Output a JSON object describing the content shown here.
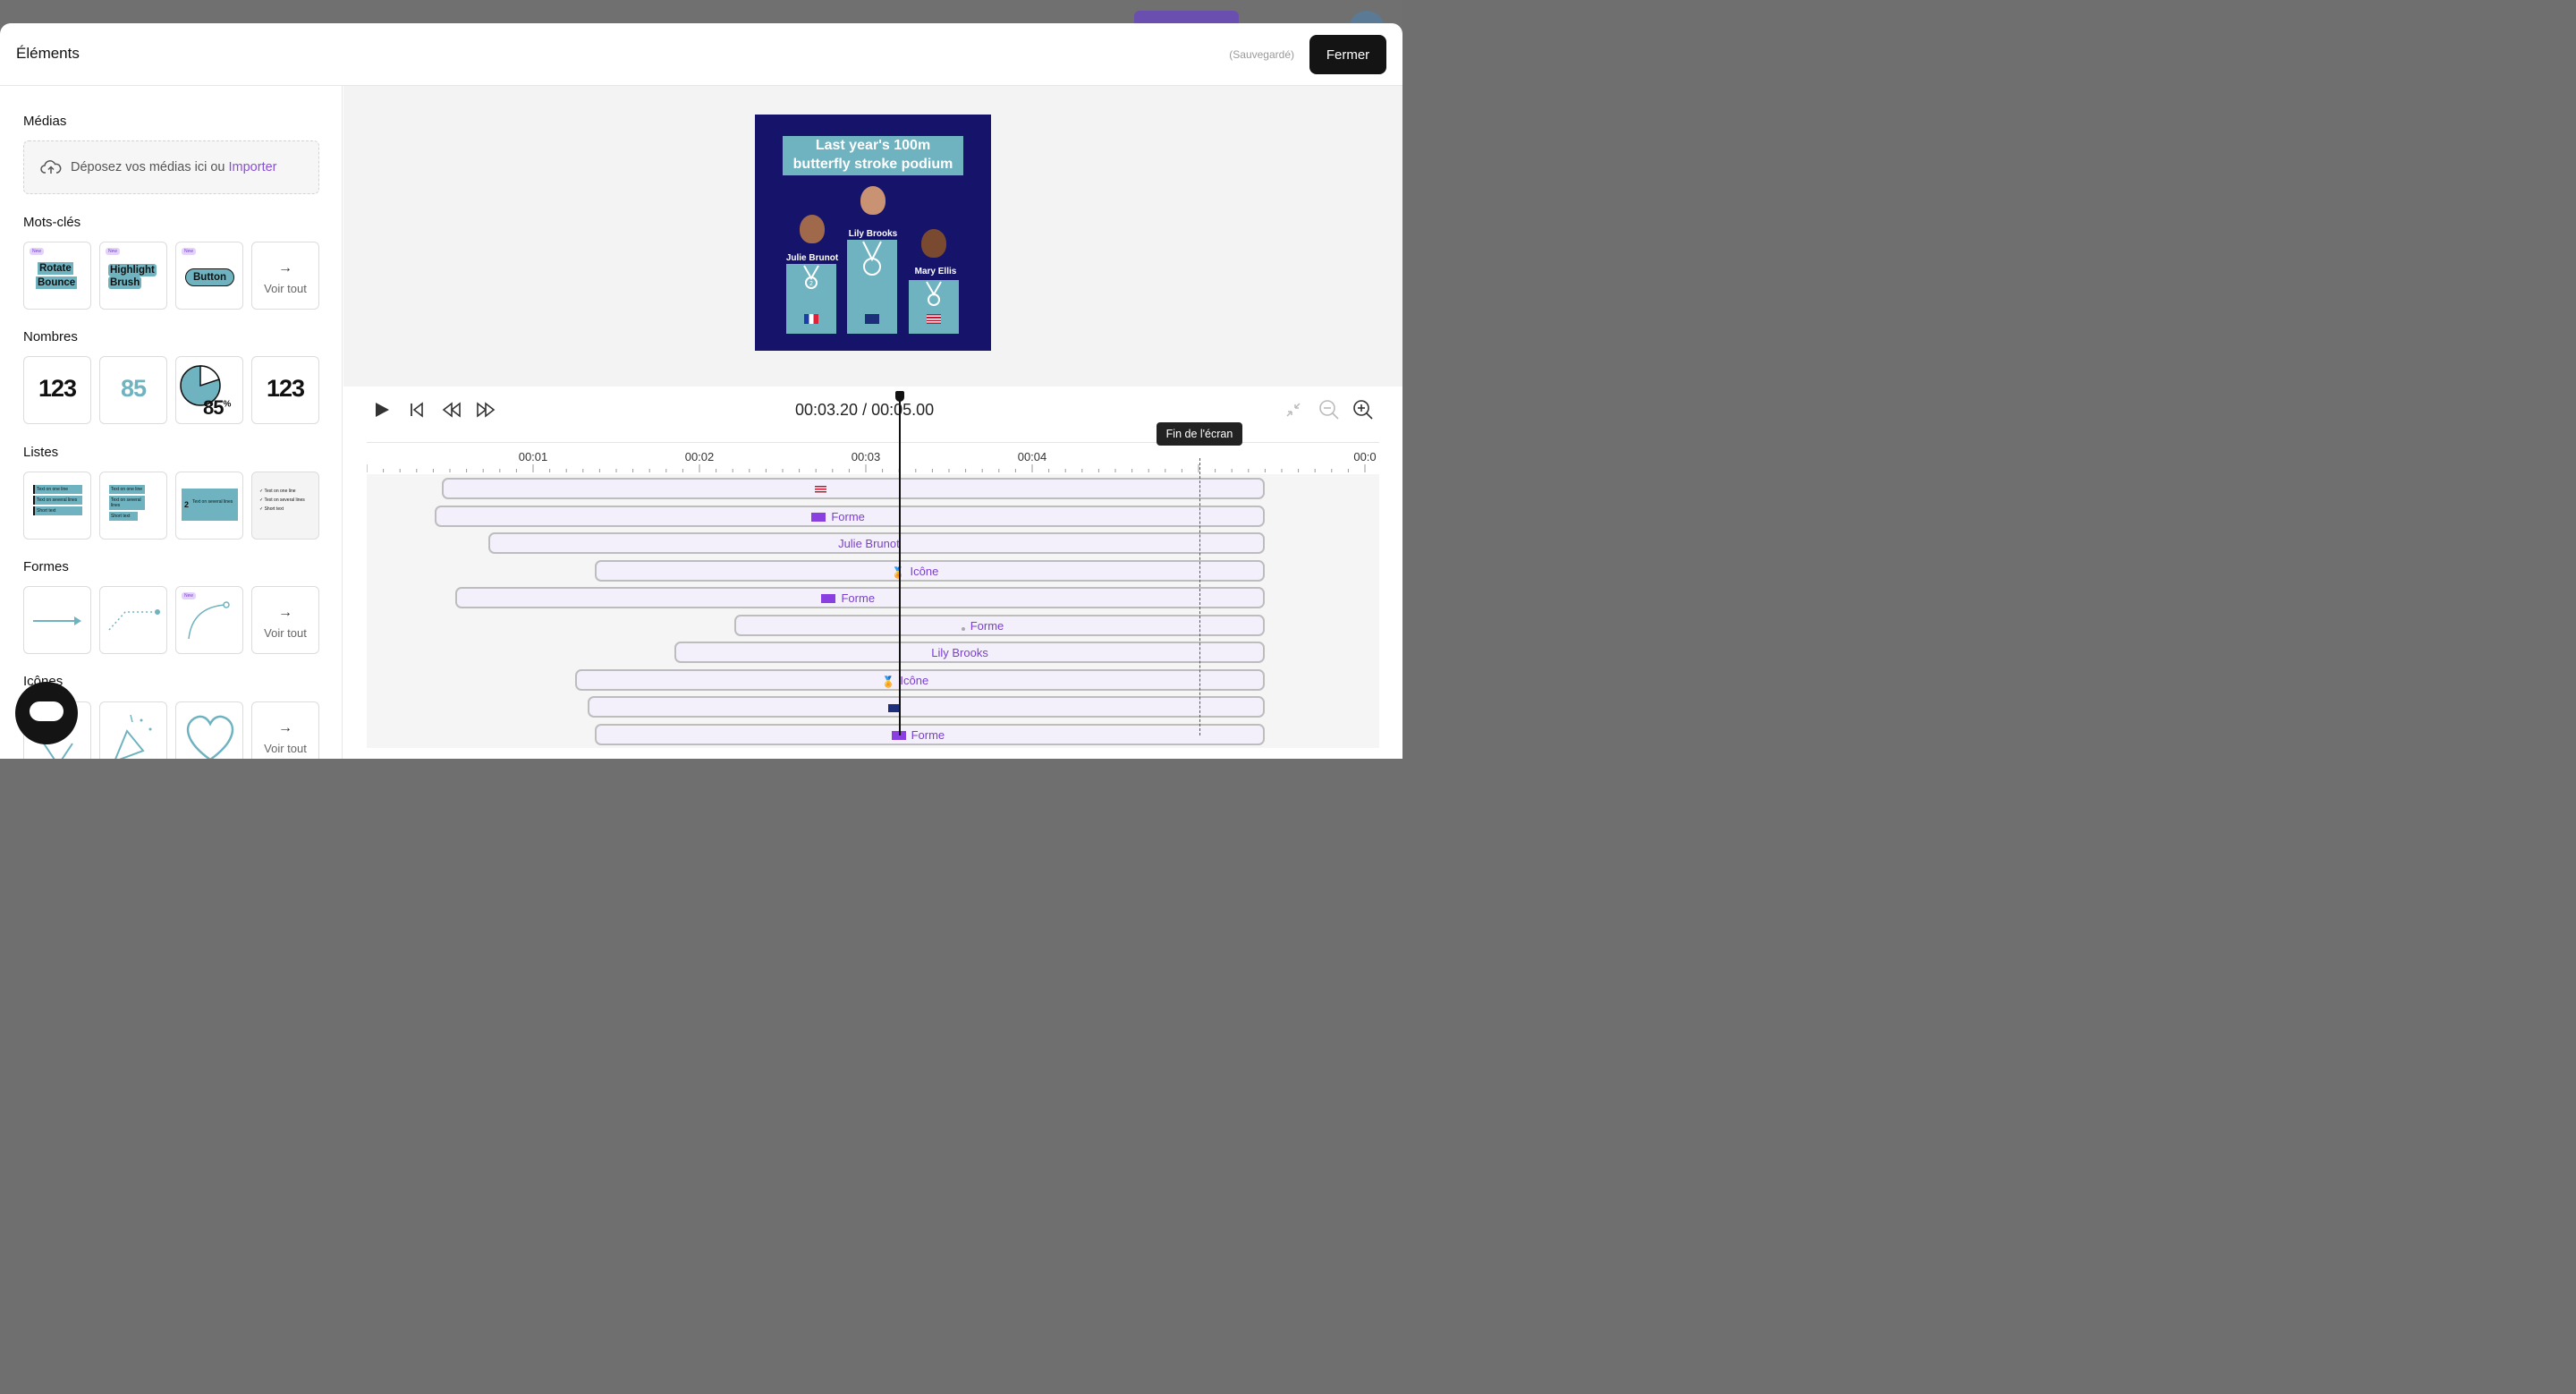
{
  "modal": {
    "title": "Éléments",
    "saved_status": "(Sauvegardé)",
    "close_label": "Fermer"
  },
  "sidebar": {
    "medias": {
      "title": "Médias",
      "drop_text": "Déposez vos médias ici ou ",
      "import_link": "Importer"
    },
    "keywords": {
      "title": "Mots-clés",
      "new_badge": "New",
      "items": [
        {
          "lines": [
            "Rotate",
            "Bounce"
          ]
        },
        {
          "lines": [
            "Highlight",
            "Brush"
          ]
        },
        {
          "lines": [
            "Button"
          ]
        }
      ],
      "see_all": "Voir tout"
    },
    "numbers": {
      "title": "Nombres",
      "items": [
        "123",
        "85",
        "85",
        "123"
      ],
      "percent": "%",
      "pie_percent": 85
    },
    "lists": {
      "title": "Listes",
      "items": [
        [
          "Text on one line",
          "Text on several lines",
          "Short text"
        ],
        [
          "Text on one line",
          "Text on several lines",
          "Short text"
        ],
        [
          "Text on several lines"
        ],
        [
          "Text on one line",
          "Text on several lines",
          "Short text"
        ]
      ],
      "number_marker": "2"
    },
    "shapes": {
      "title": "Formes",
      "see_all": "Voir tout"
    },
    "icons": {
      "title": "Icônes",
      "see_all": "Voir tout"
    }
  },
  "preview": {
    "title_line1": "Last year's 100m",
    "title_line2": "butterfly stroke podium",
    "athletes": [
      {
        "name": "Julie Brunot",
        "medal": "2",
        "flag": "fr"
      },
      {
        "name": "Lily Brooks",
        "medal": "1",
        "flag": "uk"
      },
      {
        "name": "Mary Ellis",
        "medal": "3",
        "flag": "us"
      }
    ]
  },
  "player": {
    "time_display": "00:03.20 / 00:05.00",
    "ruler_labels": [
      "00:01",
      "00:02",
      "00:03",
      "00:04",
      "00:0"
    ],
    "end_tooltip": "Fin de l'écran",
    "playhead_seconds": 3.2,
    "end_seconds": 5.0
  },
  "tracks": [
    {
      "label": "",
      "type": "flag-us",
      "start": 0.45,
      "end": 5.4
    },
    {
      "label": "Forme",
      "type": "shape",
      "start": 0.41,
      "end": 5.4
    },
    {
      "label": "Julie Brunot",
      "type": "text",
      "start": 0.73,
      "end": 5.4
    },
    {
      "label": "Icône",
      "type": "icon",
      "start": 1.37,
      "end": 5.4
    },
    {
      "label": "Forme",
      "type": "shape",
      "start": 0.53,
      "end": 5.4
    },
    {
      "label": "Forme",
      "type": "shape-dots",
      "start": 2.21,
      "end": 5.4
    },
    {
      "label": "Lily Brooks",
      "type": "text",
      "start": 1.85,
      "end": 5.4
    },
    {
      "label": "Icône",
      "type": "icon",
      "start": 1.25,
      "end": 5.4
    },
    {
      "label": "",
      "type": "flag-uk",
      "start": 1.33,
      "end": 5.4
    },
    {
      "label": "Forme",
      "type": "shape",
      "start": 1.37,
      "end": 5.4
    }
  ],
  "colors": {
    "accent": "#8a4fd8",
    "teal": "#6fb3c0",
    "navy": "#15146a",
    "dark": "#141414"
  }
}
